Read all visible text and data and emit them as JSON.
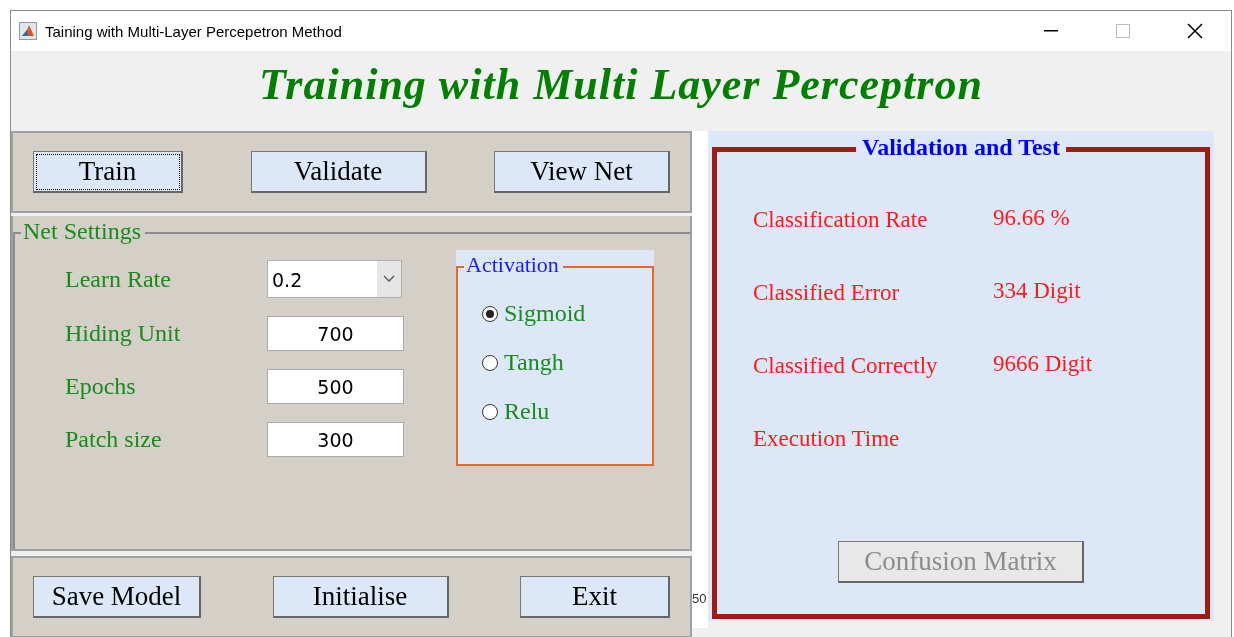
{
  "window": {
    "title": "Taining with Multi-Layer Percepetron Method"
  },
  "heading": "Training with Multi Layer Perceptron",
  "top_buttons": [
    {
      "label": "Train",
      "focused": true
    },
    {
      "label": "Validate",
      "focused": false
    },
    {
      "label": "View Net",
      "focused": false
    }
  ],
  "net_settings": {
    "title": "Net Settings",
    "fields": [
      {
        "kind": "dropdown",
        "label": "Learn Rate",
        "value": "0.2"
      },
      {
        "kind": "text",
        "label": "Hiding Unit",
        "value": "700"
      },
      {
        "kind": "text",
        "label": "Epochs",
        "value": "500"
      },
      {
        "kind": "text",
        "label": "Patch size",
        "value": "300"
      }
    ]
  },
  "activation": {
    "title": "Activation",
    "options": [
      {
        "label": "Sigmoid",
        "selected": true
      },
      {
        "label": "Tangh",
        "selected": false
      },
      {
        "label": "Relu",
        "selected": false
      }
    ]
  },
  "bottom_buttons": [
    "Save Model",
    "Initialise",
    "Exit"
  ],
  "axis_fragment": "50",
  "validation": {
    "title": "Validation and Test",
    "rows": [
      {
        "label": "Classification Rate",
        "value": "96.66 %"
      },
      {
        "label": "Classified Error",
        "value": "334 Digit"
      },
      {
        "label": "Classified Correctly",
        "value": "9666 Digit"
      },
      {
        "label": "Execution Time"
      }
    ],
    "button": {
      "label": "Confusion Matrix",
      "disabled": true
    }
  }
}
